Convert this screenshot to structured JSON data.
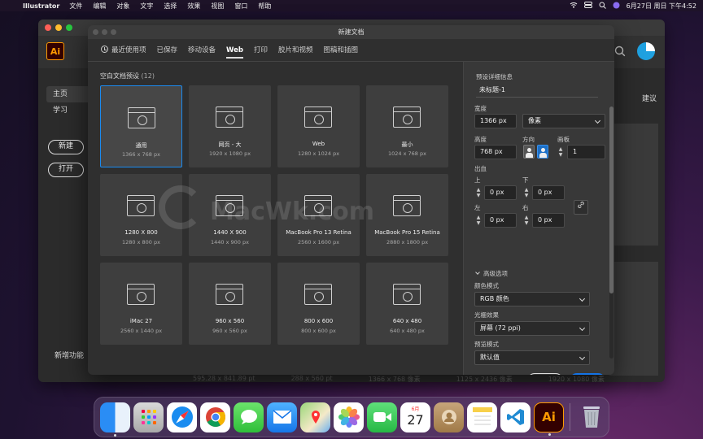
{
  "menubar": {
    "app": "Illustrator",
    "items": [
      "文件",
      "编辑",
      "对象",
      "文字",
      "选择",
      "效果",
      "视图",
      "窗口",
      "帮助"
    ],
    "datetime": "6月27日 周日 下午4:52"
  },
  "home": {
    "nav": [
      "主页",
      "学习"
    ],
    "new_button": "新建",
    "open_button": "打开",
    "new_features": "新增功能",
    "suggest": "建议",
    "recent_sizes": [
      "595.28 x 841.89 pt",
      "288 x 560 pt",
      "1366 x 768 像素",
      "1125 x 2436 像素",
      "1920 x 1080 像素"
    ]
  },
  "dialog": {
    "title": "新建文档",
    "tabs": [
      "最近使用项",
      "已保存",
      "移动设备",
      "Web",
      "打印",
      "胶片和视频",
      "图稿和插图"
    ],
    "active_tab": "Web",
    "section_title": "空白文档预设",
    "section_count": "(12)",
    "presets": [
      {
        "name": "通用",
        "size": "1366 x 768 px",
        "selected": true
      },
      {
        "name": "网页 - 大",
        "size": "1920 x 1080 px"
      },
      {
        "name": "Web",
        "size": "1280 x 1024 px"
      },
      {
        "name": "最小",
        "size": "1024 x 768 px"
      },
      {
        "name": "1280 X 800",
        "size": "1280 x 800 px"
      },
      {
        "name": "1440 X 900",
        "size": "1440 x 900 px"
      },
      {
        "name": "MacBook Pro 13 Retina",
        "size": "2560 x 1600 px"
      },
      {
        "name": "MacBook Pro 15 Retina",
        "size": "2880 x 1800 px"
      },
      {
        "name": "iMac 27",
        "size": "2560 x 1440 px"
      },
      {
        "name": "960 x 560",
        "size": "960 x 560 px"
      },
      {
        "name": "800 x 600",
        "size": "800 x 600 px"
      },
      {
        "name": "640 x 480",
        "size": "640 x 480 px"
      }
    ],
    "details": {
      "heading": "预设详细信息",
      "doc_name": "未标题-1",
      "width_label": "宽度",
      "width": "1366 px",
      "unit": "像素",
      "height_label": "高度",
      "height": "768 px",
      "orientation_label": "方向",
      "artboards_label": "画板",
      "artboards": "1",
      "bleed_label": "出血",
      "top_label": "上",
      "bottom_label": "下",
      "left_label": "左",
      "right_label": "右",
      "bleed_top": "0 px",
      "bleed_bottom": "0 px",
      "bleed_left": "0 px",
      "bleed_right": "0 px",
      "advanced": "高级选项",
      "color_mode_label": "颜色模式",
      "color_mode": "RGB 颜色",
      "raster_label": "光栅效果",
      "raster": "屏幕 (72 ppi)",
      "preview_label": "预览模式",
      "preview": "默认值"
    },
    "close_button": "关闭",
    "create_button": "创建"
  },
  "watermark": "MacWk.com",
  "dock": {
    "calendar_month": "6月",
    "calendar_day": "27",
    "ai_label": "Ai"
  }
}
